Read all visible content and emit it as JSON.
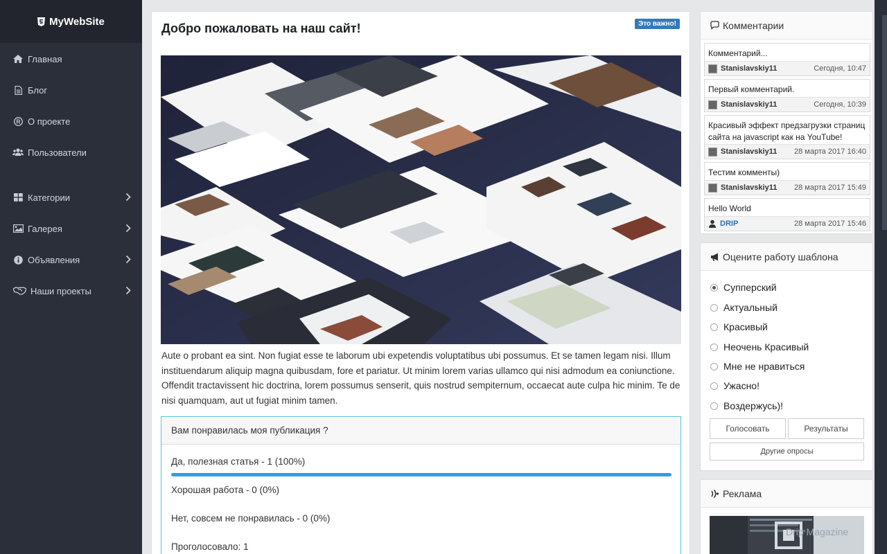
{
  "brand": {
    "name": "MyWebSite",
    "icon": "html5-icon"
  },
  "nav": {
    "items": [
      {
        "label": "Главная",
        "icon": "home-icon",
        "has_submenu": false
      },
      {
        "label": "Блог",
        "icon": "file-icon",
        "has_submenu": false
      },
      {
        "label": "О проекте",
        "icon": "registered-icon",
        "has_submenu": false
      },
      {
        "label": "Пользователи",
        "icon": "users-icon",
        "has_submenu": false
      },
      {
        "label": "Категории",
        "icon": "grid-icon",
        "has_submenu": true
      },
      {
        "label": "Галерея",
        "icon": "image-icon",
        "has_submenu": true
      },
      {
        "label": "Объявления",
        "icon": "info-icon",
        "has_submenu": true
      },
      {
        "label": "Наши проекты",
        "icon": "handshake-icon",
        "has_submenu": true
      }
    ]
  },
  "post": {
    "title": "Добро пожаловать на наш сайт!",
    "badge": "Это важно!",
    "text": "Aute o probant ea sint. Non fugiat esse te laborum ubi expetendis voluptatibus ubi possumus. Et se tamen legam nisi. Illum instituendarum aliquip magna quibusdam, fore et pariatur. Ut minim lorem varias ullamco qui nisi admodum ea coniunctione. Offendit tractavissent hic doctrina, lorem possumus senserit, quis nostrud sempiternum, occaecat aute culpa hic minim. Te de nisi quamquam, aut ut fugiat minim tamen."
  },
  "poll": {
    "question": "Вам понравилась моя публикация ?",
    "options": [
      {
        "label": "Да, полезная статья - 1 (100%)",
        "percent": 100
      },
      {
        "label": "Хорошая работа - 0 (0%)",
        "percent": 0
      },
      {
        "label": "Нет, совсем не понравилась - 0 (0%)",
        "percent": 0
      }
    ],
    "total": "Проголосовало: 1"
  },
  "comments": {
    "title": "Комментарии",
    "icon": "comments-icon",
    "items": [
      {
        "text": "Комментарий...",
        "author": "Stanislavskiy11",
        "time": "Сегодня, 10:47"
      },
      {
        "text": "Первый комментарий.",
        "author": "Stanislavskiy11",
        "time": "Сегодня, 10:39"
      },
      {
        "text": "Красивый эффект предзагрузки страниц сайта на javascript как на YouTube!",
        "author": "Stanislavskiy11",
        "time": "28 марта 2017 16:40"
      },
      {
        "text": "Тестим комменты)",
        "author": "Stanislavskiy11",
        "time": "28 марта 2017 15:49"
      },
      {
        "text": "Hello World",
        "author": "DRIP",
        "time": "28 марта 2017 15:46"
      }
    ]
  },
  "vote": {
    "title": "Оцените работу шаблона",
    "icon": "bullhorn-icon",
    "options": [
      "Супперский",
      "Актуальный",
      "Красивый",
      "Неочень Красивый",
      "Мне не нравиться",
      "Ужасно!",
      "Воздержусь)!"
    ],
    "selected_index": 0,
    "vote_button": "Голосовать",
    "results_button": "Результаты",
    "other_button": "Другие опросы"
  },
  "ads": {
    "title": "Реклама",
    "icon": "signal-icon",
    "image_watermark": "Drip Magazine"
  }
}
